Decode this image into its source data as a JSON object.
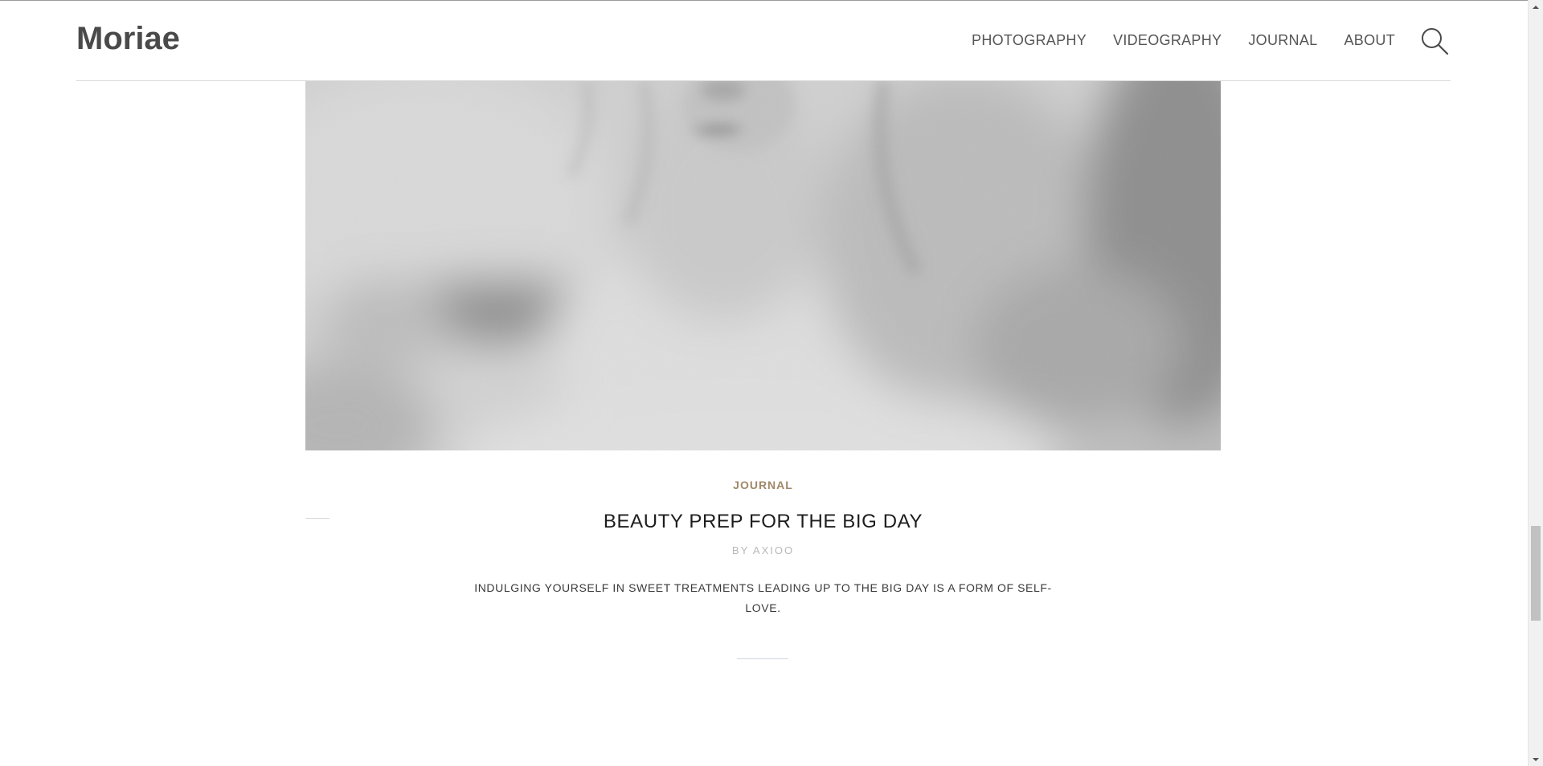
{
  "site": {
    "logo": "Moriae"
  },
  "nav": {
    "items": [
      {
        "label": "PHOTOGRAPHY"
      },
      {
        "label": "VIDEOGRAPHY"
      },
      {
        "label": "JOURNAL"
      },
      {
        "label": "ABOUT"
      }
    ],
    "search_icon": "search-icon"
  },
  "post": {
    "image_description_icon": "photo",
    "category": "JOURNAL",
    "title": "BEAUTY PREP FOR THE BIG DAY",
    "author": "BY AXIOO",
    "excerpt": "INDULGING YOURSELF IN SWEET TREATMENTS LEADING UP TO THE BIG DAY IS A FORM OF SELF-LOVE."
  },
  "colors": {
    "accent": "#a08868",
    "logo": "#4a4a4a",
    "nav_text": "#555555",
    "title": "#1d1d1d",
    "author": "#b8b8b8"
  },
  "scrollbar": {
    "up_icon": "chevron-up-icon",
    "down_icon": "chevron-down-icon"
  }
}
